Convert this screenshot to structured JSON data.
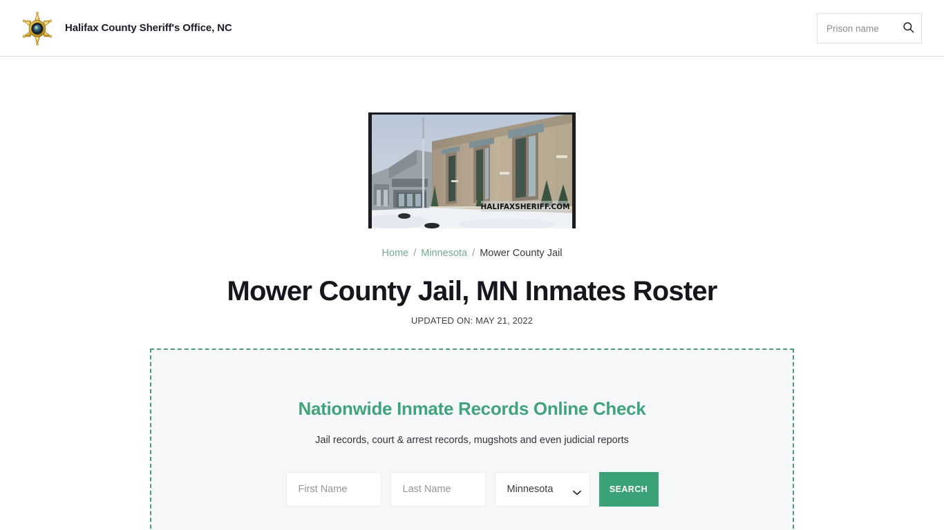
{
  "header": {
    "logo_icon": "sheriff-star-badge-icon",
    "brand_title": "Halifax County Sheriff's Office, NC",
    "search": {
      "placeholder": "Prison name",
      "value": "",
      "icon": "search-icon"
    }
  },
  "hero": {
    "image_alt": "Mower County Jail building exterior in winter",
    "watermark": "HALIFAXSHERIFF.COM"
  },
  "breadcrumb": {
    "items": [
      {
        "label": "Home",
        "link": true
      },
      {
        "label": "Minnesota",
        "link": true
      },
      {
        "label": "Mower County Jail",
        "link": false
      }
    ],
    "separator": "/"
  },
  "main": {
    "title": "Mower County Jail, MN Inmates Roster",
    "updated_on": "UPDATED ON: MAY 21, 2022"
  },
  "promo": {
    "title": "Nationwide Inmate Records Online Check",
    "subtitle": "Jail records, court & arrest records, mugshots and even judicial reports",
    "first_name_placeholder": "First Name",
    "first_name_value": "",
    "last_name_placeholder": "Last Name",
    "last_name_value": "",
    "state_selected": "Minnesota",
    "state_options": [
      "Minnesota"
    ],
    "chevron_icon": "chevron-down-icon",
    "search_label": "SEARCH"
  },
  "colors": {
    "accent_green": "#3ba177",
    "promo_title_green": "#41a37b",
    "dashed_border_green": "#4a9d79",
    "link_green": "#76ab90",
    "promo_bg": "#f6f7f8",
    "page_bg": "#ffffff",
    "text_dark": "#16161d"
  }
}
